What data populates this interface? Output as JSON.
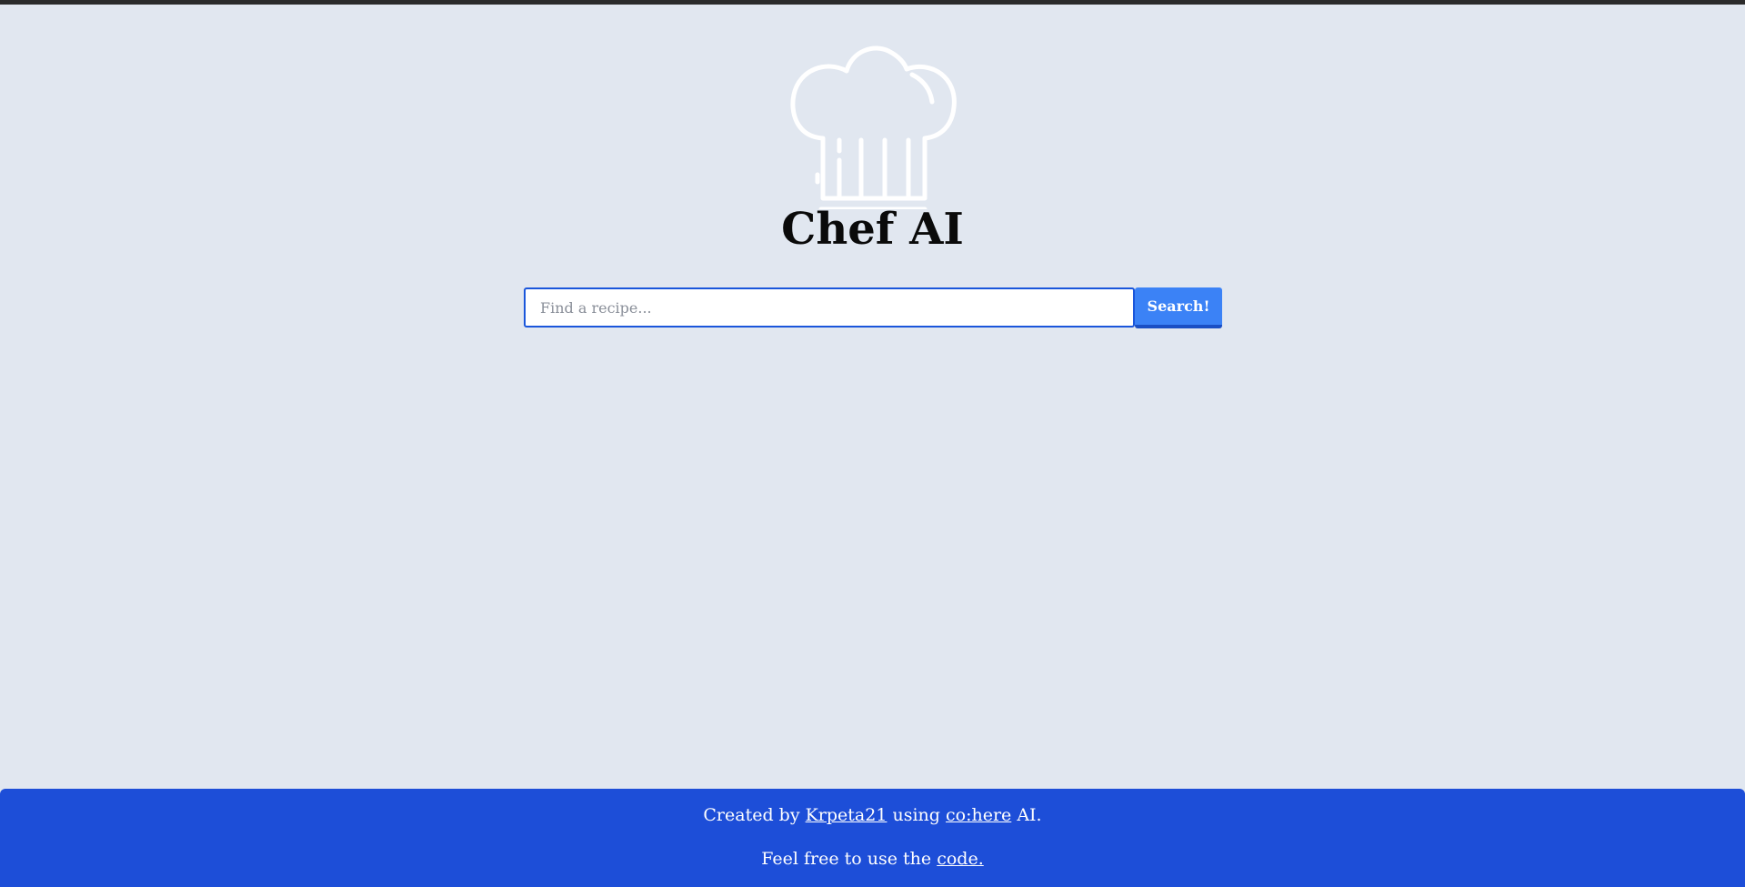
{
  "app": {
    "title": "Chef AI",
    "logo_icon": "chef-hat-icon"
  },
  "search": {
    "placeholder": "Find a recipe...",
    "value": "",
    "button_label": "Search!"
  },
  "footer": {
    "line1_prefix": "Created by ",
    "author_link": "Krpeta21",
    "line1_middle": " using ",
    "cohere_link": "co:here",
    "line1_suffix": " AI.",
    "line2_prefix": "Feel free to use the ",
    "code_link": "code."
  },
  "colors": {
    "background": "#e1e7f0",
    "accent": "#3b82f6",
    "footer": "#1d4ed8",
    "input_border": "#1a56db"
  }
}
